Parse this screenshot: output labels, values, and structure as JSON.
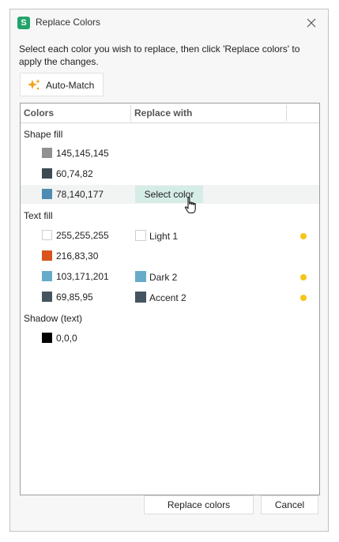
{
  "window": {
    "title": "Replace Colors",
    "app_icon_letter": "S"
  },
  "instructions": "Select each color you wish to replace, then click 'Replace colors' to apply the changes.",
  "automatch_label": "Auto-Match",
  "table": {
    "headers": [
      "Colors",
      "Replace with"
    ],
    "groups": [
      {
        "label": "Shape fill",
        "rows": [
          {
            "value": "145,145,145",
            "color": "#919191"
          },
          {
            "value": "60,74,82",
            "color": "#3c4a52"
          },
          {
            "value": "78,140,177",
            "color": "#4e8cb1",
            "replace_button": "Select color"
          }
        ]
      },
      {
        "label": "Text fill",
        "rows": [
          {
            "value": "255,255,255",
            "color": "#ffffff",
            "replace_label": "Light 1",
            "replace_color": "#ffffff",
            "dot": true
          },
          {
            "value": "216,83,30",
            "color": "#d8531e"
          },
          {
            "value": "103,171,201",
            "color": "#67abc9",
            "replace_label": "Dark 2",
            "replace_color": "#67abc9",
            "dot": true
          },
          {
            "value": "69,85,95",
            "color": "#45555f",
            "replace_label": "Accent 2",
            "replace_color": "#45555f",
            "dot": true
          }
        ]
      },
      {
        "label": "Shadow (text)",
        "rows": [
          {
            "value": "0,0,0",
            "color": "#000000"
          }
        ]
      }
    ]
  },
  "buttons": {
    "replace": "Replace colors",
    "cancel": "Cancel"
  },
  "colors": {
    "accent": "#22a36a",
    "select_highlight": "#d6ece7",
    "modified_dot": "#f5c518"
  }
}
